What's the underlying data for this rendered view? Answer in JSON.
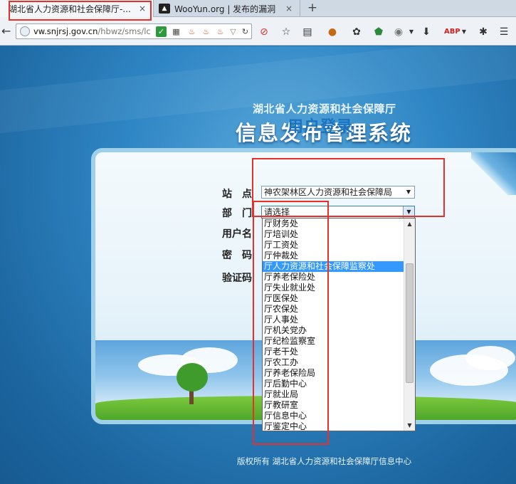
{
  "browser": {
    "tabs": [
      {
        "title": "湖北省人力资源和社会保障厅-...",
        "active": true
      },
      {
        "title": "WooYun.org | 发布的漏洞",
        "active": false,
        "icon": "wooyun-icon"
      }
    ],
    "tab_close": "×",
    "new_tab": "+",
    "address": {
      "domain": "vw.snjrsj.gov.cn",
      "path": "/hbwz/sms/lc"
    },
    "toolbar_icons": [
      "back-icon",
      "globe-icon",
      "shield-icon",
      "qr-icon",
      "java-icon",
      "java-icon",
      "java-icon",
      "dropdown-icon",
      "reload-icon",
      "blocked-icon",
      "star-icon",
      "reader-icon",
      "extension-icon",
      "palette-icon",
      "shield-addon-icon",
      "globe-addon-icon",
      "download-icon",
      "abp-icon",
      "bug-icon",
      "menu-icon"
    ]
  },
  "page": {
    "subtitle": "湖北省人力资源和社会保障厅",
    "title": "信息发布管理系统",
    "login": {
      "title": "用户登录",
      "site_label": "站　点",
      "dept_label": "部　门",
      "user_label": "用户名",
      "pwd_label": "密　码",
      "captcha_label": "验证码",
      "site_value": "神农架林区人力资源和社会保障局",
      "dept_value": "请选择"
    },
    "dept_options": [
      "厅财务处",
      "厅培训处",
      "厅工资处",
      "厅仲裁处",
      "厅人力资源和社会保障监察处",
      "厅养老保险处",
      "厅失业就业处",
      "厅医保处",
      "厅农保处",
      "厅人事处",
      "厅机关党办",
      "厅纪检监察室",
      "厅老干处",
      "厅农工办",
      "厅养老保险局",
      "厅后勤中心",
      "厅就业局",
      "厅教研室",
      "厅信息中心",
      "厅鉴定中心"
    ],
    "selected_option_index": 4,
    "footer": "版权所有 湖北省人力资源和社会保障厅信息中心"
  },
  "colors": {
    "highlight": "#3399ff",
    "annotation": "#e8302a",
    "title_blue": "#1a73c0"
  }
}
